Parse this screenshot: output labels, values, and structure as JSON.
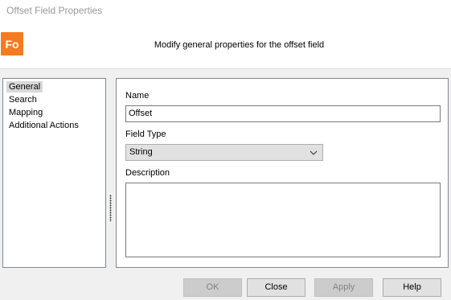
{
  "window": {
    "title": "Offset Field Properties"
  },
  "header": {
    "logo_text": "Fo",
    "logo_color": "#f47b20",
    "description": "Modify general properties for the offset field"
  },
  "nav": {
    "items": [
      {
        "label": "General",
        "selected": true
      },
      {
        "label": "Search",
        "selected": false
      },
      {
        "label": "Mapping",
        "selected": false
      },
      {
        "label": "Additional Actions",
        "selected": false
      }
    ]
  },
  "form": {
    "name_label": "Name",
    "name_value": "Offset",
    "field_type_label": "Field Type",
    "field_type_value": "String",
    "description_label": "Description",
    "description_value": ""
  },
  "buttons": {
    "ok": "OK",
    "close": "Close",
    "apply": "Apply",
    "help": "Help"
  }
}
